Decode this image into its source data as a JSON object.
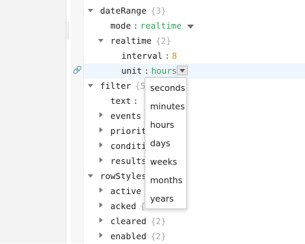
{
  "tree": {
    "dateRange": {
      "key": "dateRange",
      "count": "{3}"
    },
    "mode": {
      "key": "mode",
      "sep": ":",
      "value": "realtime"
    },
    "realtime": {
      "key": "realtime",
      "count": "{2}"
    },
    "interval": {
      "key": "interval",
      "sep": ":",
      "value": "8"
    },
    "unit": {
      "key": "unit",
      "sep": ":",
      "value": "hours"
    },
    "filter": {
      "key": "filter",
      "count": "{5}"
    },
    "text": {
      "key": "text",
      "sep": ":"
    },
    "events": {
      "key": "events"
    },
    "priority": {
      "key": "priorit"
    },
    "conditions": {
      "key": "conditi"
    },
    "results": {
      "key": "results"
    },
    "rowStyles": {
      "key": "rowStyles"
    },
    "active": {
      "key": "active"
    },
    "acked": {
      "key": "acked",
      "count": "{"
    },
    "cleared": {
      "key": "cleared",
      "count": "{2}"
    },
    "enabled": {
      "key": "enabled",
      "count": "{2}"
    }
  },
  "unit_dropdown": {
    "options": [
      "seconds",
      "minutes",
      "hours",
      "days",
      "weeks",
      "months",
      "years"
    ]
  },
  "colors": {
    "string_value": "#33a25b",
    "number_value": "#e08e1a",
    "row_highlight": "#eef5fc"
  },
  "icons": {
    "gutter_row_icon": "link-icon",
    "expanded": "triangle-down-icon",
    "collapsed": "triangle-right-icon"
  }
}
